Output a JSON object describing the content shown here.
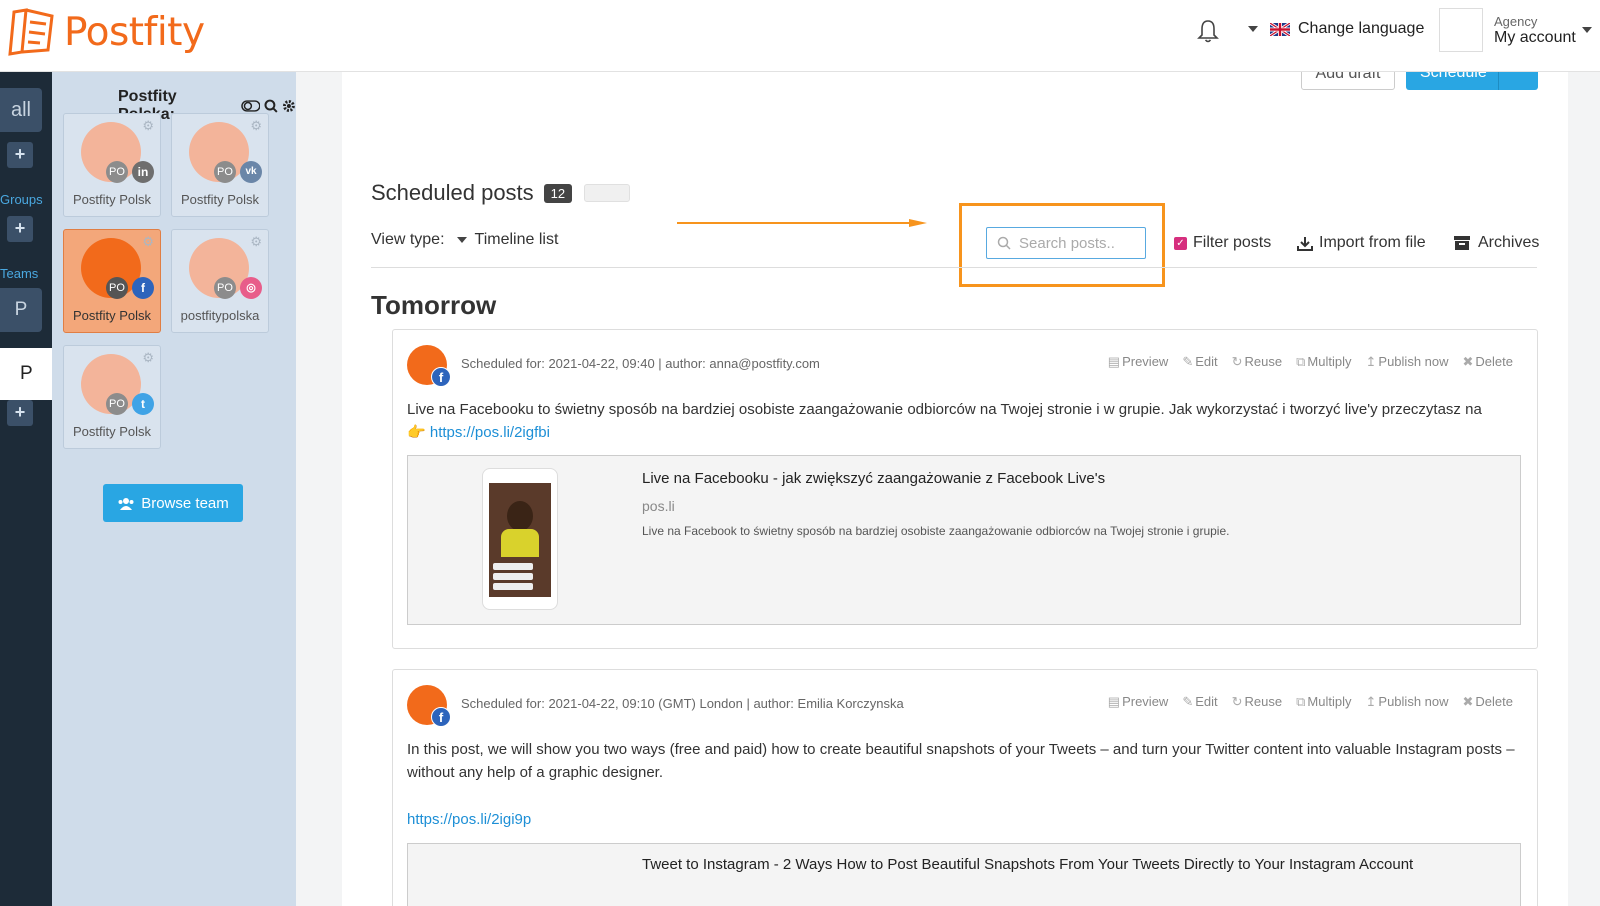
{
  "header": {
    "logo_text": "Postfity",
    "change_language": "Change language",
    "account_top": "Agency",
    "account_bottom": "My account"
  },
  "rail": {
    "all": "all",
    "groups": "Groups",
    "teams": "Teams",
    "p_item": "P",
    "p_active": "P",
    "plus": "+"
  },
  "panel": {
    "title": "Postfity Polska:",
    "tiles": [
      {
        "name": "Postfity Polsk",
        "network": "linkedin",
        "network_glyph": "in",
        "badge": "PO"
      },
      {
        "name": "Postfity Polsk",
        "network": "vk",
        "network_glyph": "vk",
        "badge": "PO"
      },
      {
        "name": "Postfity Polsk",
        "network": "facebook",
        "network_glyph": "f",
        "badge": "PO"
      },
      {
        "name": "postfitypolska",
        "network": "instagram",
        "network_glyph": "◎",
        "badge": "PO"
      },
      {
        "name": "Postfity Polsk",
        "network": "twitter",
        "network_glyph": "t",
        "badge": "PO"
      }
    ],
    "browse_team": "Browse team"
  },
  "toolbar": {
    "add_draft": "Add draft",
    "schedule": "Schedule"
  },
  "scheduled": {
    "title": "Scheduled posts",
    "count": "12",
    "view_type_label": "View type:",
    "view_type_value": "Timeline list",
    "search_placeholder": "Search posts..",
    "filter_posts": "Filter posts",
    "import": "Import from file",
    "archives": "Archives",
    "section": "Tomorrow"
  },
  "actions": {
    "preview": "Preview",
    "edit": "Edit",
    "reuse": "Reuse",
    "multiply": "Multiply",
    "publish_now": "Publish now",
    "delete": "Delete"
  },
  "posts": [
    {
      "meta": "Scheduled for: 2021-04-22, 09:40 | author: anna@postfity.com",
      "text": "Live na Facebooku to świetny sposób na bardziej osobiste zaangażowanie odbiorców na Twojej stronie i w grupie. Jak wykorzystać i tworzyć live'y przeczytasz na",
      "pointer": "👉",
      "link": "https://pos.li/2igfbi",
      "preview_title": "Live na Facebooku - jak zwiększyć zaangażowanie z Facebook Live's",
      "preview_domain": "pos.li",
      "preview_desc": "Live na Facebook to świetny sposób na bardziej osobiste zaangażowanie odbiorców na Twojej stronie i grupie."
    },
    {
      "meta": "Scheduled for: 2021-04-22, 09:10 (GMT) London | author: Emilia Korczynska",
      "text": "In this post, we will show you two ways (free and paid) how to create beautiful snapshots of your Tweets – and turn your Twitter content into valuable Instagram posts – without any help of a graphic designer.",
      "link": "https://pos.li/2igi9p",
      "preview_title": "Tweet to Instagram - 2 Ways How to Post Beautiful Snapshots From Your Tweets Directly to Your Instagram Account"
    }
  ],
  "colors": {
    "brand": "#f26a1b",
    "accent": "#29a6e3",
    "highlight": "#f7941d",
    "rail": "#1d2b38",
    "panel": "#cfdcea"
  }
}
